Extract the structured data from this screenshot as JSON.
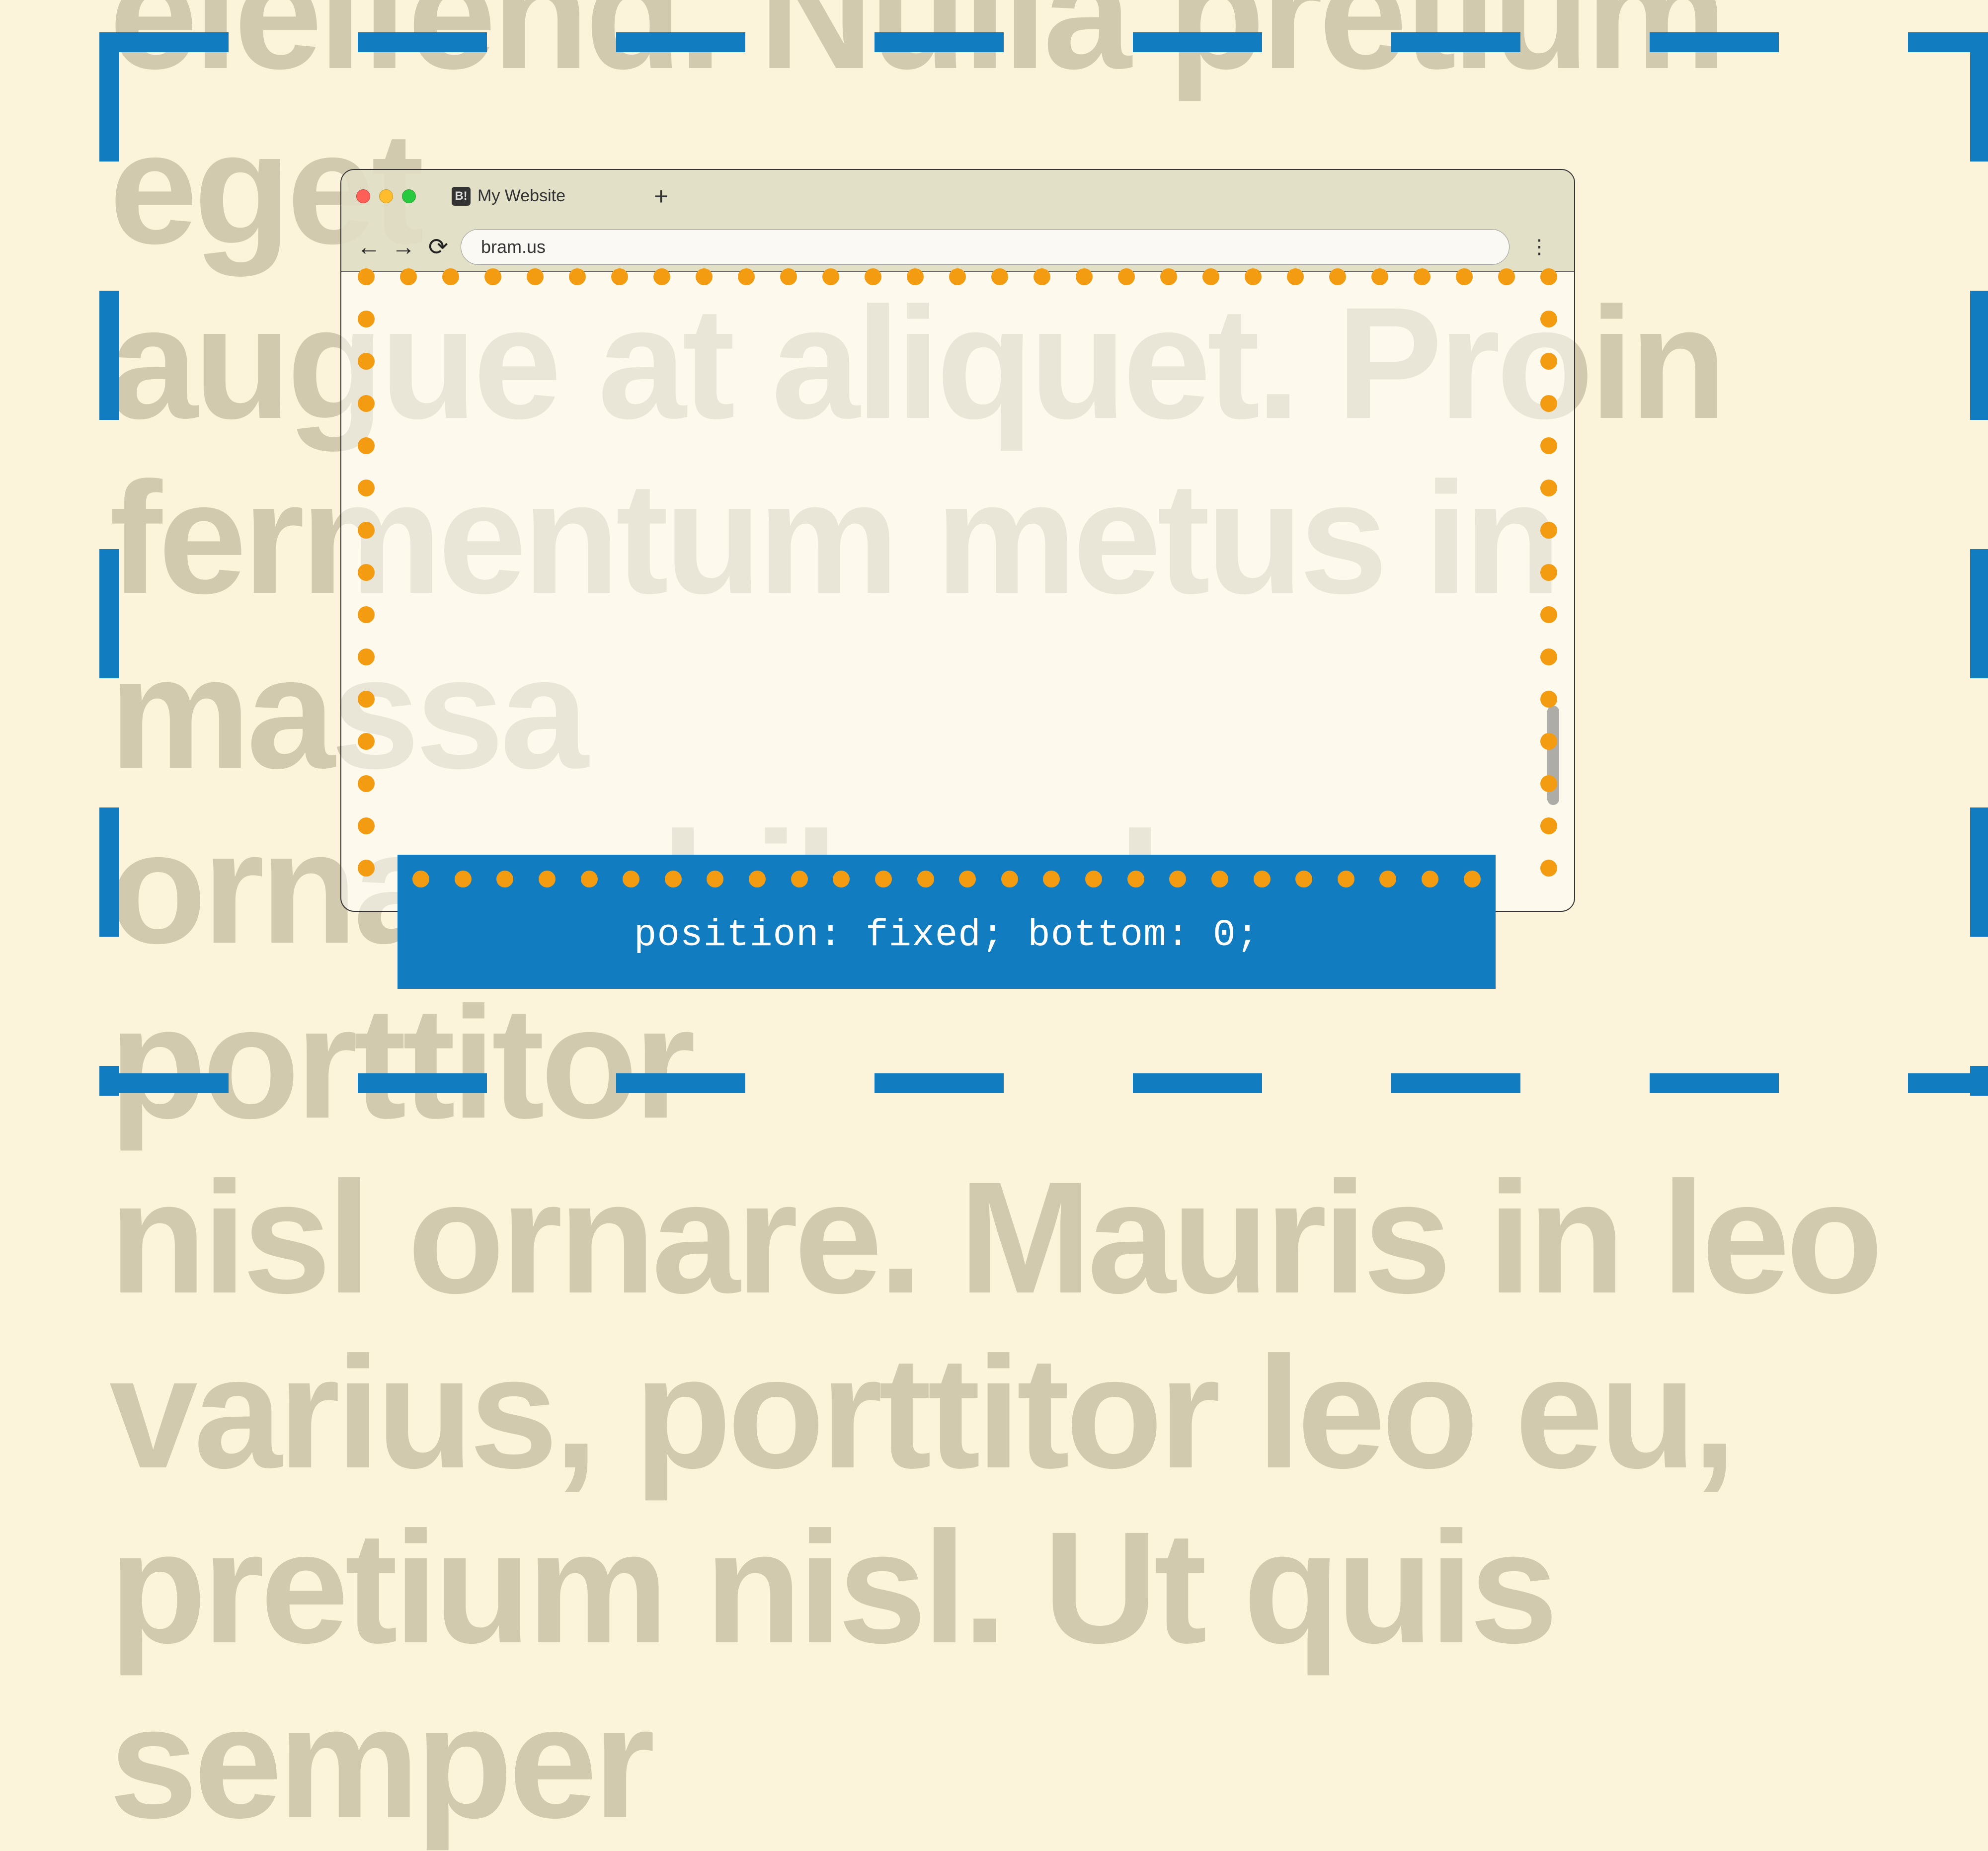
{
  "background_text": "eleifend. Nulla pretium eget\naugue at aliquet. Proin\nfermentum metus in massa\nornare, bibendum porttitor\nnisl ornare. Mauris in leo\nvarius, porttitor leo eu,\npretium nisl. Ut quis semper",
  "browser": {
    "tab_title": "My Website",
    "favicon_text": "B!",
    "url": "bram.us",
    "new_tab_glyph": "+",
    "back_glyph": "←",
    "forward_glyph": "→",
    "reload_glyph": "⟳",
    "menu_glyph": "⋮"
  },
  "footer": {
    "code": "position: fixed; bottom: 0;"
  },
  "colors": {
    "background": "#fbf4da",
    "blue": "#127cc0",
    "orange": "#f39c12",
    "muted_text": "rgba(170,160,130,0.5)"
  }
}
